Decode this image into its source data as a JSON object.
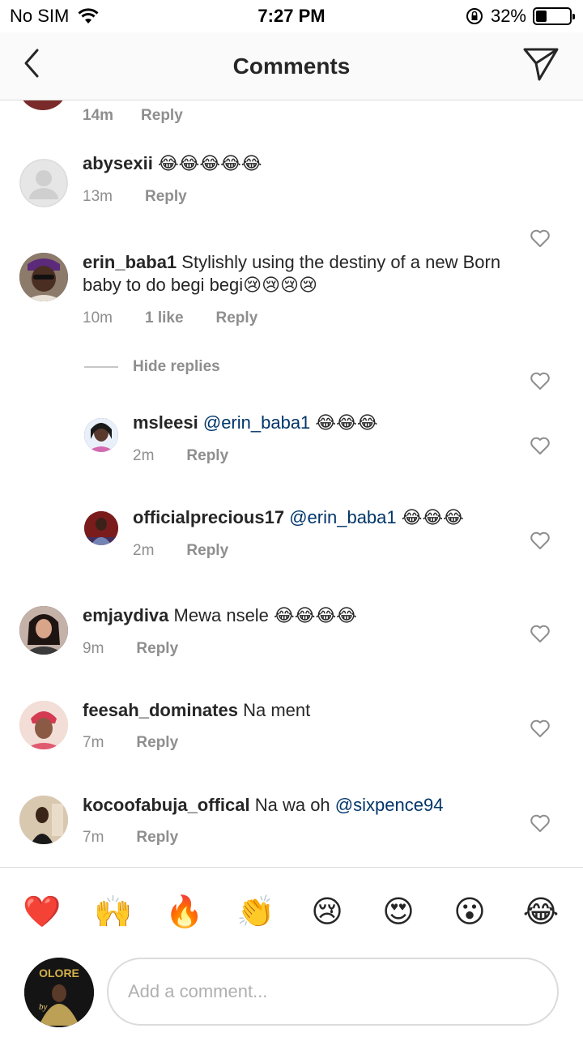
{
  "status_bar": {
    "carrier": "No SIM",
    "time": "7:27 PM",
    "battery": "32%",
    "battery_level": 0.32
  },
  "header": {
    "title": "Comments",
    "back_icon": "chevron-left-icon",
    "send_icon": "paper-plane-icon"
  },
  "partial_comment": {
    "time": "14m",
    "reply_label": "Reply"
  },
  "comments": [
    {
      "username": "abysexii",
      "text": "",
      "emoji": "😂😂😂😂😂",
      "time": "13m",
      "likes": "",
      "reply_label": "Reply"
    },
    {
      "username": "erin_baba1",
      "text": "Stylishly using the destiny of a new Born baby to do begi begi",
      "emoji": "😢😢😢😢",
      "time": "10m",
      "likes": "1 like",
      "reply_label": "Reply"
    }
  ],
  "hide_replies_label": "Hide replies",
  "replies": [
    {
      "username": "msleesi",
      "mention": "@erin_baba1",
      "emoji": "😂😂😂",
      "time": "2m",
      "reply_label": "Reply"
    },
    {
      "username": "officialprecious17",
      "mention": "@erin_baba1",
      "emoji": "😂😂😂",
      "time": "2m",
      "reply_label": "Reply"
    }
  ],
  "more_comments": [
    {
      "username": "emjaydiva",
      "text": "Mewa nsele",
      "emoji": "😂😂😂😂",
      "mention": "",
      "time": "9m",
      "reply_label": "Reply"
    },
    {
      "username": "feesah_dominates",
      "text": "Na ment",
      "emoji": "",
      "mention": "",
      "time": "7m",
      "reply_label": "Reply"
    },
    {
      "username": "kocoofabuja_offical",
      "text": "Na wa oh",
      "emoji": "",
      "mention": "@sixpence94",
      "time": "7m",
      "reply_label": "Reply"
    }
  ],
  "quick_reactions": [
    "❤️",
    "🙌",
    "🔥",
    "👏",
    "😢",
    "😍",
    "😮",
    "😂"
  ],
  "composer": {
    "placeholder": "Add a comment...",
    "avatar_text_top": "OLORE",
    "avatar_text_bottom": "by"
  },
  "colors": {
    "mention": "#003569",
    "secondary_text": "#8e8e8e",
    "border": "#dbdbdb"
  }
}
